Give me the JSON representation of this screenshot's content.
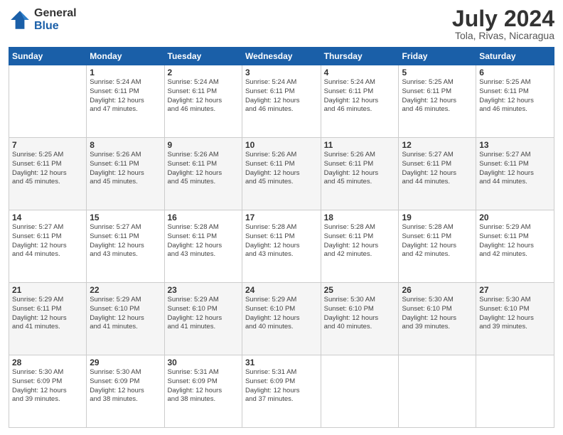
{
  "header": {
    "logo_general": "General",
    "logo_blue": "Blue",
    "month_title": "July 2024",
    "location": "Tola, Rivas, Nicaragua"
  },
  "days_of_week": [
    "Sunday",
    "Monday",
    "Tuesday",
    "Wednesday",
    "Thursday",
    "Friday",
    "Saturday"
  ],
  "weeks": [
    [
      {
        "day": "",
        "info": ""
      },
      {
        "day": "1",
        "info": "Sunrise: 5:24 AM\nSunset: 6:11 PM\nDaylight: 12 hours\nand 47 minutes."
      },
      {
        "day": "2",
        "info": "Sunrise: 5:24 AM\nSunset: 6:11 PM\nDaylight: 12 hours\nand 46 minutes."
      },
      {
        "day": "3",
        "info": "Sunrise: 5:24 AM\nSunset: 6:11 PM\nDaylight: 12 hours\nand 46 minutes."
      },
      {
        "day": "4",
        "info": "Sunrise: 5:24 AM\nSunset: 6:11 PM\nDaylight: 12 hours\nand 46 minutes."
      },
      {
        "day": "5",
        "info": "Sunrise: 5:25 AM\nSunset: 6:11 PM\nDaylight: 12 hours\nand 46 minutes."
      },
      {
        "day": "6",
        "info": "Sunrise: 5:25 AM\nSunset: 6:11 PM\nDaylight: 12 hours\nand 46 minutes."
      }
    ],
    [
      {
        "day": "7",
        "info": "Sunrise: 5:25 AM\nSunset: 6:11 PM\nDaylight: 12 hours\nand 45 minutes."
      },
      {
        "day": "8",
        "info": "Sunrise: 5:26 AM\nSunset: 6:11 PM\nDaylight: 12 hours\nand 45 minutes."
      },
      {
        "day": "9",
        "info": "Sunrise: 5:26 AM\nSunset: 6:11 PM\nDaylight: 12 hours\nand 45 minutes."
      },
      {
        "day": "10",
        "info": "Sunrise: 5:26 AM\nSunset: 6:11 PM\nDaylight: 12 hours\nand 45 minutes."
      },
      {
        "day": "11",
        "info": "Sunrise: 5:26 AM\nSunset: 6:11 PM\nDaylight: 12 hours\nand 45 minutes."
      },
      {
        "day": "12",
        "info": "Sunrise: 5:27 AM\nSunset: 6:11 PM\nDaylight: 12 hours\nand 44 minutes."
      },
      {
        "day": "13",
        "info": "Sunrise: 5:27 AM\nSunset: 6:11 PM\nDaylight: 12 hours\nand 44 minutes."
      }
    ],
    [
      {
        "day": "14",
        "info": "Sunrise: 5:27 AM\nSunset: 6:11 PM\nDaylight: 12 hours\nand 44 minutes."
      },
      {
        "day": "15",
        "info": "Sunrise: 5:27 AM\nSunset: 6:11 PM\nDaylight: 12 hours\nand 43 minutes."
      },
      {
        "day": "16",
        "info": "Sunrise: 5:28 AM\nSunset: 6:11 PM\nDaylight: 12 hours\nand 43 minutes."
      },
      {
        "day": "17",
        "info": "Sunrise: 5:28 AM\nSunset: 6:11 PM\nDaylight: 12 hours\nand 43 minutes."
      },
      {
        "day": "18",
        "info": "Sunrise: 5:28 AM\nSunset: 6:11 PM\nDaylight: 12 hours\nand 42 minutes."
      },
      {
        "day": "19",
        "info": "Sunrise: 5:28 AM\nSunset: 6:11 PM\nDaylight: 12 hours\nand 42 minutes."
      },
      {
        "day": "20",
        "info": "Sunrise: 5:29 AM\nSunset: 6:11 PM\nDaylight: 12 hours\nand 42 minutes."
      }
    ],
    [
      {
        "day": "21",
        "info": "Sunrise: 5:29 AM\nSunset: 6:11 PM\nDaylight: 12 hours\nand 41 minutes."
      },
      {
        "day": "22",
        "info": "Sunrise: 5:29 AM\nSunset: 6:10 PM\nDaylight: 12 hours\nand 41 minutes."
      },
      {
        "day": "23",
        "info": "Sunrise: 5:29 AM\nSunset: 6:10 PM\nDaylight: 12 hours\nand 41 minutes."
      },
      {
        "day": "24",
        "info": "Sunrise: 5:29 AM\nSunset: 6:10 PM\nDaylight: 12 hours\nand 40 minutes."
      },
      {
        "day": "25",
        "info": "Sunrise: 5:30 AM\nSunset: 6:10 PM\nDaylight: 12 hours\nand 40 minutes."
      },
      {
        "day": "26",
        "info": "Sunrise: 5:30 AM\nSunset: 6:10 PM\nDaylight: 12 hours\nand 39 minutes."
      },
      {
        "day": "27",
        "info": "Sunrise: 5:30 AM\nSunset: 6:10 PM\nDaylight: 12 hours\nand 39 minutes."
      }
    ],
    [
      {
        "day": "28",
        "info": "Sunrise: 5:30 AM\nSunset: 6:09 PM\nDaylight: 12 hours\nand 39 minutes."
      },
      {
        "day": "29",
        "info": "Sunrise: 5:30 AM\nSunset: 6:09 PM\nDaylight: 12 hours\nand 38 minutes."
      },
      {
        "day": "30",
        "info": "Sunrise: 5:31 AM\nSunset: 6:09 PM\nDaylight: 12 hours\nand 38 minutes."
      },
      {
        "day": "31",
        "info": "Sunrise: 5:31 AM\nSunset: 6:09 PM\nDaylight: 12 hours\nand 37 minutes."
      },
      {
        "day": "",
        "info": ""
      },
      {
        "day": "",
        "info": ""
      },
      {
        "day": "",
        "info": ""
      }
    ]
  ]
}
